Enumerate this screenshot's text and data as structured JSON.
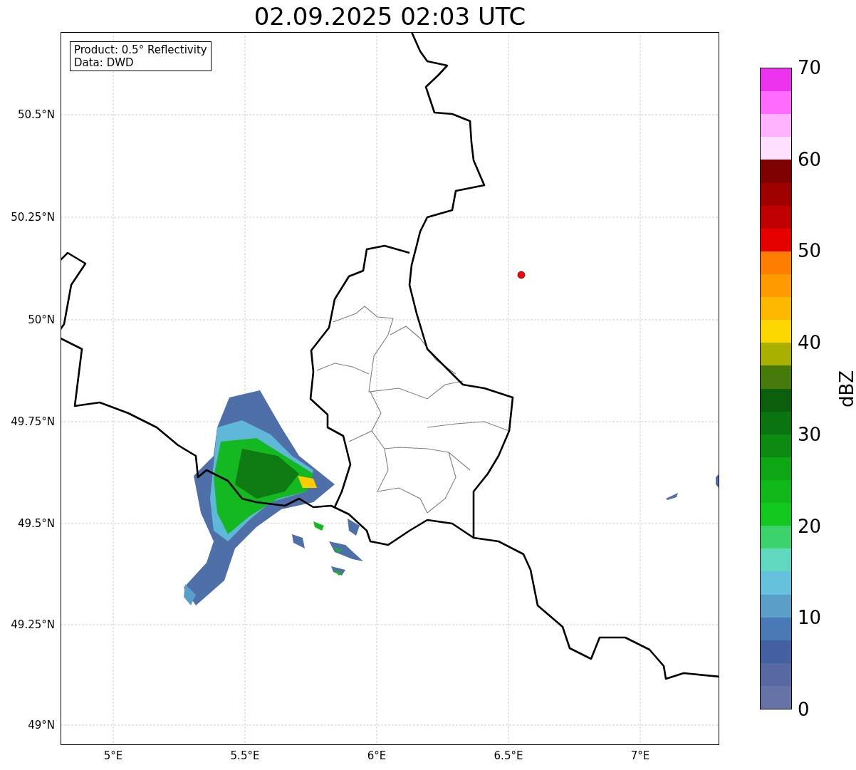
{
  "title": "02.09.2025 02:03 UTC",
  "info_box": {
    "lines": [
      "Product: 0.5° Reflectivity",
      "Data: DWD"
    ]
  },
  "map": {
    "latitude_labels": [
      "50.5°N",
      "50.25°N",
      "50°N",
      "49.75°N",
      "49.5°N",
      "49.25°N",
      "49°N"
    ],
    "longitude_labels": [
      "5°E",
      "5.5°E",
      "6°E",
      "6.5°E",
      "7°E"
    ]
  },
  "colorbar": {
    "label": "dBZ",
    "ticks": [
      "70",
      "60",
      "50",
      "40",
      "30",
      "20",
      "10",
      "0"
    ],
    "segments": [
      {
        "color": "#ee33ee"
      },
      {
        "color": "#ff6aff"
      },
      {
        "color": "#ffb2ff"
      },
      {
        "color": "#ffe0ff"
      },
      {
        "color": "#7e0000"
      },
      {
        "color": "#a00000"
      },
      {
        "color": "#c00000"
      },
      {
        "color": "#e60000"
      },
      {
        "color": "#ff7d00"
      },
      {
        "color": "#ff9a00"
      },
      {
        "color": "#ffb800"
      },
      {
        "color": "#ffd700"
      },
      {
        "color": "#aab000"
      },
      {
        "color": "#467a0a"
      },
      {
        "color": "#0b5e0c"
      },
      {
        "color": "#0a7410"
      },
      {
        "color": "#0d8a12"
      },
      {
        "color": "#0fa616"
      },
      {
        "color": "#10b81a"
      },
      {
        "color": "#12c81e"
      },
      {
        "color": "#3dd36c"
      },
      {
        "color": "#60d8c0"
      },
      {
        "color": "#66c1dc"
      },
      {
        "color": "#5b9ec8"
      },
      {
        "color": "#4a7ab5"
      },
      {
        "color": "#4560a0"
      },
      {
        "color": "#5669a0"
      },
      {
        "color": "#6673a6"
      }
    ]
  }
}
